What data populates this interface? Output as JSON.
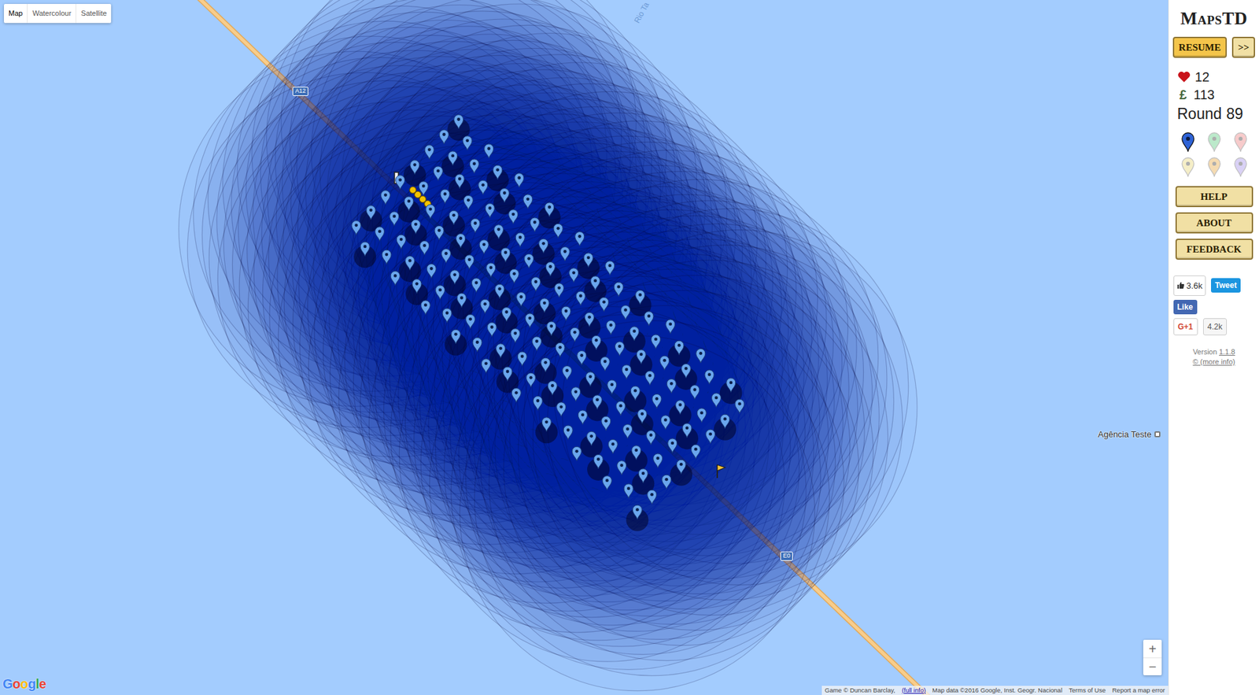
{
  "map_types": [
    {
      "label": "Map",
      "selected": true
    },
    {
      "label": "Watercolour",
      "selected": false
    },
    {
      "label": "Satellite",
      "selected": false
    }
  ],
  "map": {
    "road_labels": [
      "A12",
      "E0"
    ],
    "river_label": "Rio Ta",
    "place_label": "Agência Teste",
    "towers": 160,
    "creeps": 4,
    "zoom": [
      "+",
      "−"
    ],
    "google": "Google",
    "attribution": [
      {
        "text": "Game © Duncan Barclay,",
        "link": false
      },
      {
        "text": "(full info)",
        "link": true
      },
      {
        "text": "Map data ©2016 Google, Inst. Geogr. Nacional",
        "link": false
      },
      {
        "text": "Terms of Use",
        "link": false
      },
      {
        "text": "Report a map error",
        "link": false
      }
    ]
  },
  "sidebar": {
    "logo": "MapsTD",
    "resume": "RESUME",
    "fast": ">>",
    "lives": "12",
    "money_symbol": "£",
    "money": "113",
    "round_label": "Round",
    "round": "89",
    "tower_types": [
      {
        "color": "#2f63d6",
        "selected": true
      },
      {
        "color": "#8fdca8",
        "selected": false
      },
      {
        "color": "#f3a9a9",
        "selected": false
      },
      {
        "color": "#efe3a2",
        "selected": false
      },
      {
        "color": "#f0c47e",
        "selected": false
      },
      {
        "color": "#c1b3ef",
        "selected": false
      }
    ],
    "menu": [
      "HELP",
      "ABOUT",
      "FEEDBACK"
    ],
    "social": {
      "likes": "3.6k",
      "tweet": "Tweet",
      "fb": "Like",
      "gplus": "G+1",
      "gplus_count": "4.2k"
    },
    "version_label": "Version",
    "version": "1.1.8",
    "more_info": "© (more info)"
  }
}
